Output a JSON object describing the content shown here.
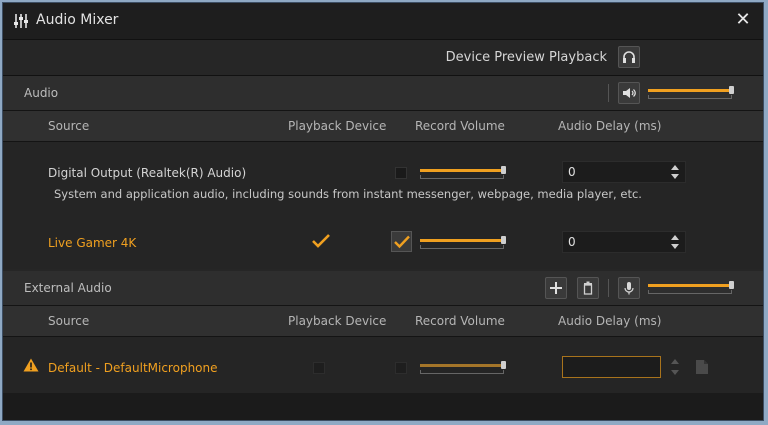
{
  "window": {
    "title": "Audio Mixer",
    "close_label": "✕"
  },
  "preview": {
    "label": "Device Preview Playback",
    "icon": "headphones-icon"
  },
  "audio": {
    "section_label": "Audio",
    "master_volume": 0.97,
    "columns": {
      "source": "Source",
      "playback": "Playback Device",
      "record": "Record Volume",
      "delay": "Audio Delay (ms)"
    },
    "rows": [
      {
        "name": "Digital Output (Realtek(R) Audio)",
        "description": "System and application audio, including sounds from instant messenger, webpage, media player, etc.",
        "record_checked": false,
        "volume": 0.97,
        "delay": "0"
      },
      {
        "name": "Live Gamer 4K",
        "playback_checked": true,
        "record_checked": true,
        "volume": 0.97,
        "delay": "0"
      }
    ]
  },
  "external": {
    "section_label": "External Audio",
    "master_volume": 0.97,
    "columns": {
      "source": "Source",
      "playback": "Playback Device",
      "record": "Record Volume",
      "delay": "Audio Delay (ms)"
    },
    "rows": [
      {
        "name": "Default - DefaultMicrophone",
        "warning": true,
        "volume": 0.97,
        "delay": ""
      }
    ]
  },
  "colors": {
    "accent": "#f0a020",
    "window_bg": "#262626",
    "outer_bg": "#8fa9c4"
  }
}
